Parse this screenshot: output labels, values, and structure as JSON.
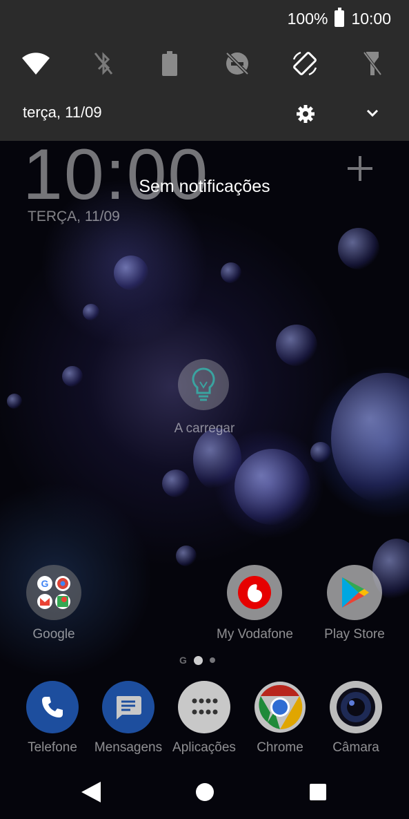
{
  "status_bar": {
    "battery": "100%",
    "time": "10:00"
  },
  "quick_settings": {
    "tiles": [
      "wifi-icon",
      "bluetooth-off-icon",
      "battery-saver-icon",
      "do-not-disturb-off-icon",
      "auto-rotate-icon",
      "flashlight-off-icon"
    ],
    "date": "terça, 11/09"
  },
  "lockscreen": {
    "clock": "10:00",
    "date": "TERÇA, 11/09",
    "notifications": "Sem notificações",
    "charging_label": "A carregar"
  },
  "home_apps": [
    {
      "label": "Google"
    },
    {
      "label": "My Vodafone"
    },
    {
      "label": "Play Store"
    }
  ],
  "dock_apps": [
    {
      "label": "Telefone"
    },
    {
      "label": "Mensagens"
    },
    {
      "label": "Aplicações"
    },
    {
      "label": "Chrome"
    },
    {
      "label": "Câmara"
    }
  ],
  "colors": {
    "shade_bg": "#2b2b2b",
    "phone_blue": "#1a56c8",
    "vodafone_red": "#e60000"
  }
}
